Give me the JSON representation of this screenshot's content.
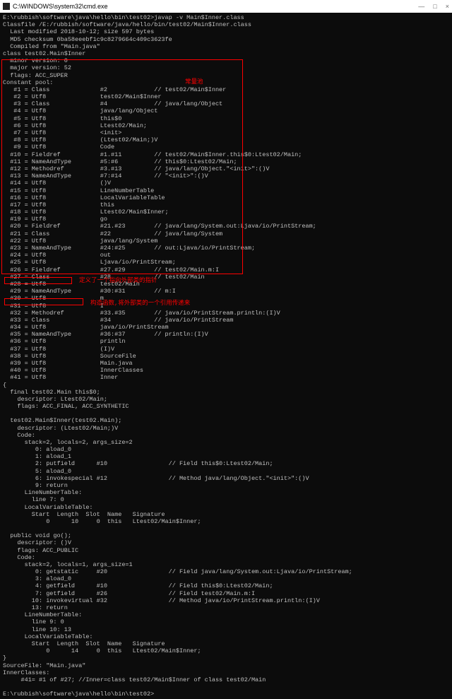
{
  "window": {
    "title": "C:\\WINDOWS\\system32\\cmd.exe",
    "btn_min": "—",
    "btn_max": "□",
    "btn_close": "×"
  },
  "notes": {
    "constant_pool": "常量池",
    "field_pointer": "定义了一个指向外部类的指针",
    "constructor_ref": "构造函数,将外部类的一个引用传递来"
  },
  "lines": [
    "E:\\rubbish\\software\\java\\hello\\bin\\test02>javap -v Main$Inner.class",
    "Classfile /E:/rubbish/software/java/hello/bin/test02/Main$Inner.class",
    "  Last modified 2018-10-12; size 597 bytes",
    "  MD5 checksum 0ba58eeebf1c9c8279664c409c3623fe",
    "  Compiled from \"Main.java\"",
    "class test02.Main$Inner",
    "  minor version: 0",
    "  major version: 52",
    "  flags: ACC_SUPER",
    "Constant pool:",
    "   #1 = Class              #2             // test02/Main$Inner",
    "   #2 = Utf8               test02/Main$Inner",
    "   #3 = Class              #4             // java/lang/Object",
    "   #4 = Utf8               java/lang/Object",
    "   #5 = Utf8               this$0",
    "   #6 = Utf8               Ltest02/Main;",
    "   #7 = Utf8               <init>",
    "   #8 = Utf8               (Ltest02/Main;)V",
    "   #9 = Utf8               Code",
    "  #10 = Fieldref           #1.#11         // test02/Main$Inner.this$0:Ltest02/Main;",
    "  #11 = NameAndType        #5:#6          // this$0:Ltest02/Main;",
    "  #12 = Methodref          #3.#13         // java/lang/Object.\"<init>\":()V",
    "  #13 = NameAndType        #7:#14         // \"<init>\":()V",
    "  #14 = Utf8               ()V",
    "  #15 = Utf8               LineNumberTable",
    "  #16 = Utf8               LocalVariableTable",
    "  #17 = Utf8               this",
    "  #18 = Utf8               Ltest02/Main$Inner;",
    "  #19 = Utf8               go",
    "  #20 = Fieldref           #21.#23        // java/lang/System.out:Ljava/io/PrintStream;",
    "  #21 = Class              #22            // java/lang/System",
    "  #22 = Utf8               java/lang/System",
    "  #23 = NameAndType        #24:#25        // out:Ljava/io/PrintStream;",
    "  #24 = Utf8               out",
    "  #25 = Utf8               Ljava/io/PrintStream;",
    "  #26 = Fieldref           #27.#29        // test02/Main.m:I",
    "  #27 = Class              #28            // test02/Main",
    "  #28 = Utf8               test02/Main",
    "  #29 = NameAndType        #30:#31        // m:I",
    "  #30 = Utf8               m",
    "  #31 = Utf8               I",
    "  #32 = Methodref          #33.#35        // java/io/PrintStream.println:(I)V",
    "  #33 = Class              #34            // java/io/PrintStream",
    "  #34 = Utf8               java/io/PrintStream",
    "  #35 = NameAndType        #36:#37        // println:(I)V",
    "  #36 = Utf8               println",
    "  #37 = Utf8               (I)V",
    "  #38 = Utf8               SourceFile",
    "  #39 = Utf8               Main.java",
    "  #40 = Utf8               InnerClasses",
    "  #41 = Utf8               Inner",
    "{",
    "  final test02.Main this$0;",
    "    descriptor: Ltest02/Main;",
    "    flags: ACC_FINAL, ACC_SYNTHETIC",
    "",
    "  test02.Main$Inner(test02.Main);",
    "    descriptor: (Ltest02/Main;)V",
    "    Code:",
    "      stack=2, locals=2, args_size=2",
    "         0: aload_0",
    "         1: aload_1",
    "         2: putfield      #10                 // Field this$0:Ltest02/Main;",
    "         5: aload_0",
    "         6: invokespecial #12                 // Method java/lang/Object.\"<init>\":()V",
    "         9: return",
    "      LineNumberTable:",
    "        line 7: 0",
    "      LocalVariableTable:",
    "        Start  Length  Slot  Name   Signature",
    "            0      10     0  this   Ltest02/Main$Inner;",
    "",
    "  public void go();",
    "    descriptor: ()V",
    "    flags: ACC_PUBLIC",
    "    Code:",
    "      stack=2, locals=1, args_size=1",
    "         0: getstatic     #20                 // Field java/lang/System.out:Ljava/io/PrintStream;",
    "         3: aload_0",
    "         4: getfield      #10                 // Field this$0:Ltest02/Main;",
    "         7: getfield      #26                 // Field test02/Main.m:I",
    "        10: invokevirtual #32                 // Method java/io/PrintStream.println:(I)V",
    "        13: return",
    "      LineNumberTable:",
    "        line 9: 0",
    "        line 10: 13",
    "      LocalVariableTable:",
    "        Start  Length  Slot  Name   Signature",
    "            0      14     0  this   Ltest02/Main$Inner;",
    "}",
    "SourceFile: \"Main.java\"",
    "InnerClasses:",
    "     #41= #1 of #27; //Inner=class test02/Main$Inner of class test02/Main",
    "",
    "E:\\rubbish\\software\\java\\hello\\bin\\test02>"
  ]
}
